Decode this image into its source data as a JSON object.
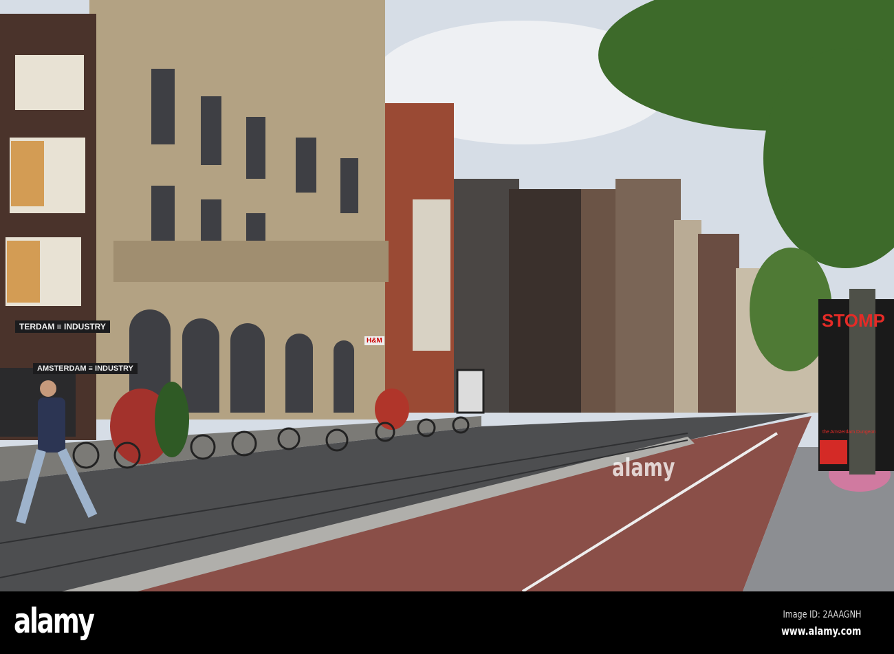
{
  "watermark": {
    "logo": "alamy",
    "image_id": "Image ID: 2AAAGNH",
    "url": "www.alamy.com",
    "overlay_text": "alamy"
  },
  "signs": {
    "shop_upper": "TERDAM ≡ INDUSTRY",
    "shop_awning": "AMSTERDAM ≡ INDUSTRY",
    "store_brand": "H&M",
    "poster_title": "STOMP",
    "poster_subtitle": "the Amsterdam Dungeon"
  },
  "colors": {
    "sky": "#d6dde6",
    "brick_lane": "#8a4f48",
    "asphalt": "#4d4e50",
    "stone_building": "#b9a88c",
    "tree": "#3d6a2a"
  }
}
